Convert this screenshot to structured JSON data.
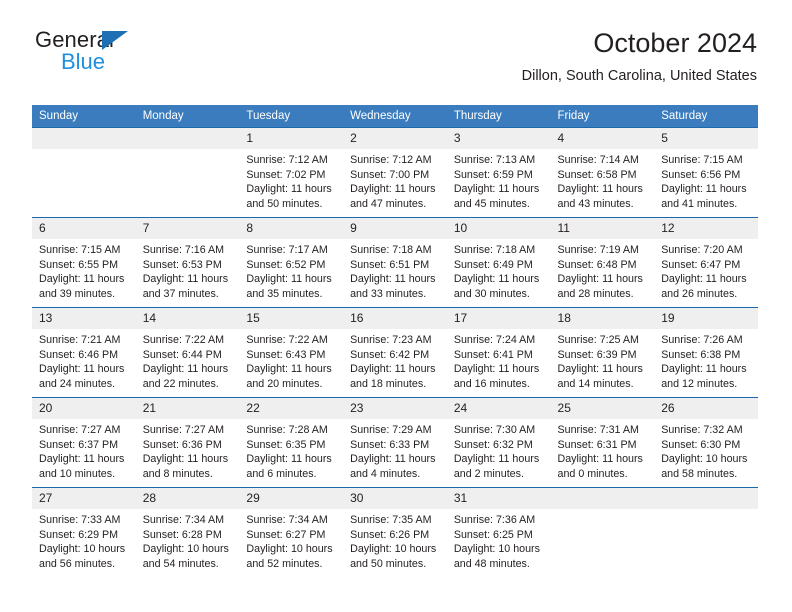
{
  "brand": {
    "name_dark": "General",
    "name_light": "Blue",
    "accent_blue": "#1f8fe0",
    "triangle_blue": "#1f6fb5"
  },
  "header": {
    "title": "October 2024",
    "subtitle": "Dillon, South Carolina, United States"
  },
  "calendar": {
    "header_bg": "#3a7cbe",
    "row_rule": "#1b68ad",
    "daynum_bg": "#efefef",
    "weekday_headers": [
      "Sunday",
      "Monday",
      "Tuesday",
      "Wednesday",
      "Thursday",
      "Friday",
      "Saturday"
    ],
    "weeks": [
      [
        {
          "day": "",
          "lines": []
        },
        {
          "day": "",
          "lines": []
        },
        {
          "day": "1",
          "lines": [
            "Sunrise: 7:12 AM",
            "Sunset: 7:02 PM",
            "Daylight: 11 hours",
            "and 50 minutes."
          ]
        },
        {
          "day": "2",
          "lines": [
            "Sunrise: 7:12 AM",
            "Sunset: 7:00 PM",
            "Daylight: 11 hours",
            "and 47 minutes."
          ]
        },
        {
          "day": "3",
          "lines": [
            "Sunrise: 7:13 AM",
            "Sunset: 6:59 PM",
            "Daylight: 11 hours",
            "and 45 minutes."
          ]
        },
        {
          "day": "4",
          "lines": [
            "Sunrise: 7:14 AM",
            "Sunset: 6:58 PM",
            "Daylight: 11 hours",
            "and 43 minutes."
          ]
        },
        {
          "day": "5",
          "lines": [
            "Sunrise: 7:15 AM",
            "Sunset: 6:56 PM",
            "Daylight: 11 hours",
            "and 41 minutes."
          ]
        }
      ],
      [
        {
          "day": "6",
          "lines": [
            "Sunrise: 7:15 AM",
            "Sunset: 6:55 PM",
            "Daylight: 11 hours",
            "and 39 minutes."
          ]
        },
        {
          "day": "7",
          "lines": [
            "Sunrise: 7:16 AM",
            "Sunset: 6:53 PM",
            "Daylight: 11 hours",
            "and 37 minutes."
          ]
        },
        {
          "day": "8",
          "lines": [
            "Sunrise: 7:17 AM",
            "Sunset: 6:52 PM",
            "Daylight: 11 hours",
            "and 35 minutes."
          ]
        },
        {
          "day": "9",
          "lines": [
            "Sunrise: 7:18 AM",
            "Sunset: 6:51 PM",
            "Daylight: 11 hours",
            "and 33 minutes."
          ]
        },
        {
          "day": "10",
          "lines": [
            "Sunrise: 7:18 AM",
            "Sunset: 6:49 PM",
            "Daylight: 11 hours",
            "and 30 minutes."
          ]
        },
        {
          "day": "11",
          "lines": [
            "Sunrise: 7:19 AM",
            "Sunset: 6:48 PM",
            "Daylight: 11 hours",
            "and 28 minutes."
          ]
        },
        {
          "day": "12",
          "lines": [
            "Sunrise: 7:20 AM",
            "Sunset: 6:47 PM",
            "Daylight: 11 hours",
            "and 26 minutes."
          ]
        }
      ],
      [
        {
          "day": "13",
          "lines": [
            "Sunrise: 7:21 AM",
            "Sunset: 6:46 PM",
            "Daylight: 11 hours",
            "and 24 minutes."
          ]
        },
        {
          "day": "14",
          "lines": [
            "Sunrise: 7:22 AM",
            "Sunset: 6:44 PM",
            "Daylight: 11 hours",
            "and 22 minutes."
          ]
        },
        {
          "day": "15",
          "lines": [
            "Sunrise: 7:22 AM",
            "Sunset: 6:43 PM",
            "Daylight: 11 hours",
            "and 20 minutes."
          ]
        },
        {
          "day": "16",
          "lines": [
            "Sunrise: 7:23 AM",
            "Sunset: 6:42 PM",
            "Daylight: 11 hours",
            "and 18 minutes."
          ]
        },
        {
          "day": "17",
          "lines": [
            "Sunrise: 7:24 AM",
            "Sunset: 6:41 PM",
            "Daylight: 11 hours",
            "and 16 minutes."
          ]
        },
        {
          "day": "18",
          "lines": [
            "Sunrise: 7:25 AM",
            "Sunset: 6:39 PM",
            "Daylight: 11 hours",
            "and 14 minutes."
          ]
        },
        {
          "day": "19",
          "lines": [
            "Sunrise: 7:26 AM",
            "Sunset: 6:38 PM",
            "Daylight: 11 hours",
            "and 12 minutes."
          ]
        }
      ],
      [
        {
          "day": "20",
          "lines": [
            "Sunrise: 7:27 AM",
            "Sunset: 6:37 PM",
            "Daylight: 11 hours",
            "and 10 minutes."
          ]
        },
        {
          "day": "21",
          "lines": [
            "Sunrise: 7:27 AM",
            "Sunset: 6:36 PM",
            "Daylight: 11 hours",
            "and 8 minutes."
          ]
        },
        {
          "day": "22",
          "lines": [
            "Sunrise: 7:28 AM",
            "Sunset: 6:35 PM",
            "Daylight: 11 hours",
            "and 6 minutes."
          ]
        },
        {
          "day": "23",
          "lines": [
            "Sunrise: 7:29 AM",
            "Sunset: 6:33 PM",
            "Daylight: 11 hours",
            "and 4 minutes."
          ]
        },
        {
          "day": "24",
          "lines": [
            "Sunrise: 7:30 AM",
            "Sunset: 6:32 PM",
            "Daylight: 11 hours",
            "and 2 minutes."
          ]
        },
        {
          "day": "25",
          "lines": [
            "Sunrise: 7:31 AM",
            "Sunset: 6:31 PM",
            "Daylight: 11 hours",
            "and 0 minutes."
          ]
        },
        {
          "day": "26",
          "lines": [
            "Sunrise: 7:32 AM",
            "Sunset: 6:30 PM",
            "Daylight: 10 hours",
            "and 58 minutes."
          ]
        }
      ],
      [
        {
          "day": "27",
          "lines": [
            "Sunrise: 7:33 AM",
            "Sunset: 6:29 PM",
            "Daylight: 10 hours",
            "and 56 minutes."
          ]
        },
        {
          "day": "28",
          "lines": [
            "Sunrise: 7:34 AM",
            "Sunset: 6:28 PM",
            "Daylight: 10 hours",
            "and 54 minutes."
          ]
        },
        {
          "day": "29",
          "lines": [
            "Sunrise: 7:34 AM",
            "Sunset: 6:27 PM",
            "Daylight: 10 hours",
            "and 52 minutes."
          ]
        },
        {
          "day": "30",
          "lines": [
            "Sunrise: 7:35 AM",
            "Sunset: 6:26 PM",
            "Daylight: 10 hours",
            "and 50 minutes."
          ]
        },
        {
          "day": "31",
          "lines": [
            "Sunrise: 7:36 AM",
            "Sunset: 6:25 PM",
            "Daylight: 10 hours",
            "and 48 minutes."
          ]
        },
        {
          "day": "",
          "lines": []
        },
        {
          "day": "",
          "lines": []
        }
      ]
    ]
  }
}
